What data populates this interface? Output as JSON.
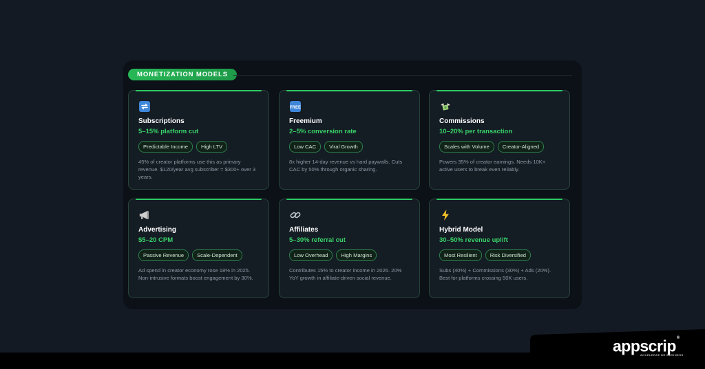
{
  "section": {
    "label": "MONETIZATION MODELS"
  },
  "cards": [
    {
      "icon": "repeat-arrows-icon",
      "title": "Subscriptions",
      "metric": "5–15% platform cut",
      "tags": [
        "Predictable Income",
        "High LTV"
      ],
      "description": "45% of creator platforms use this as primary revenue. $120/year avg subscriber = $300+ over 3 years."
    },
    {
      "icon": "free-badge-icon",
      "title": "Freemium",
      "metric": "2–5% conversion rate",
      "tags": [
        "Low CAC",
        "Viral Growth"
      ],
      "description": "8x higher 14-day revenue vs hard paywalls. Cuts CAC by 50% through organic sharing."
    },
    {
      "icon": "money-with-wings-icon",
      "title": "Commissions",
      "metric": "10–20% per transaction",
      "tags": [
        "Scales with Volume",
        "Creator-Aligned"
      ],
      "description": "Powers 35% of creator earnings. Needs 10K+ active users to break even reliably."
    },
    {
      "icon": "megaphone-icon",
      "title": "Advertising",
      "metric": "$5–20 CPM",
      "tags": [
        "Passive Revenue",
        "Scale-Dependent"
      ],
      "description": "Ad spend in creator economy rose 18% in 2025. Non-intrusive formats boost engagement by 30%."
    },
    {
      "icon": "link-icon",
      "title": "Affiliates",
      "metric": "5–30% referral cut",
      "tags": [
        "Low Overhead",
        "High Margins"
      ],
      "description": "Contributes 15% to creator income in 2026. 20% YoY growth in affiliate-driven social revenue."
    },
    {
      "icon": "lightning-icon",
      "title": "Hybrid Model",
      "metric": "30–50% revenue uplift",
      "tags": [
        "Most Resilient",
        "Risk Diversified"
      ],
      "description": "Subs (40%) + Commissions (30%) + Ads (20%). Best for platforms crossing 50K users."
    }
  ],
  "brand": {
    "name": "appscrip",
    "registered": "®",
    "tagline": "ACCELERATING BUSINESS"
  },
  "colors": {
    "accent": "#2ec964",
    "metric": "#3ad36a",
    "background": "#141a24",
    "panel": "#0c1117"
  }
}
